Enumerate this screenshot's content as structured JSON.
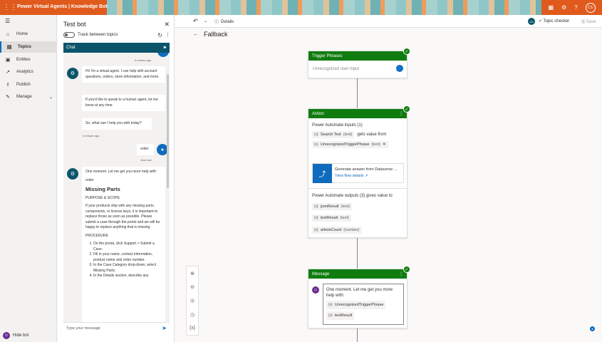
{
  "topbar": {
    "app_title": "Power Virtual Agents | Knowledge Bot",
    "avatar_initials": "CS"
  },
  "nav": {
    "items": [
      {
        "label": "Home"
      },
      {
        "label": "Topics"
      },
      {
        "label": "Entities"
      },
      {
        "label": "Analytics"
      },
      {
        "label": "Publish"
      },
      {
        "label": "Manage"
      }
    ],
    "hide_bot": "Hide bot"
  },
  "testbot": {
    "title": "Test bot",
    "track_label": "Track between topics",
    "chat_label": "Chat",
    "input_placeholder": "Type your message",
    "messages": {
      "ts1": "A minute ago",
      "m1": "Hi! I'm a virtual agent. I can help with account questions, orders, store information, and more.",
      "m2": "If you'd like to speak to a human agent, let me know at any time.",
      "m3": "So, what can I help you with today?",
      "ts2": "A minute ago",
      "user_msg": "order",
      "ts3": "Just now",
      "m4_intro": "One moment. Let me get you more help with:",
      "m4_term": "order",
      "m4_heading": "Missing Parts",
      "m4_purpose": "PURPOSE & SCOPE",
      "m4_body": "If your products ship with any missing parts, components, or license keys, it is important to replace those as soon as possible. Please submit a case through the portal and we will be happy to replace anything that is missing.",
      "m4_procedure": "PROCEDURE",
      "m4_steps": [
        "On the portal, click Support > Submit a Case.",
        "Fill in your name, contact information, product name and order number.",
        "In the Case Category drop-down, select Missing Parts.",
        "In the Details section, describe any"
      ]
    }
  },
  "canvas": {
    "details_label": "Details",
    "avatar_initials": "CS",
    "topic_checker": "Topic checker",
    "save_label": "Save",
    "page_title": "Fallback",
    "trigger": {
      "title": "Trigger Phrases",
      "text": "Unrecognized user input"
    },
    "action": {
      "title": "Action",
      "inputs_label": "Power Automate inputs (1)",
      "input_var": "Search Text",
      "input_type": "(text)",
      "gets_value_from": "gets value from",
      "source_var": "UnrecognizedTriggerPhrase",
      "source_type": "(text)",
      "flow_name": "Generate answer from Dataverse ...",
      "flow_link": "View flow details",
      "outputs_label": "Power Automate outputs (3) gives value to",
      "outputs": [
        {
          "name": "jsonResult",
          "type": "(text)"
        },
        {
          "name": "textResult",
          "type": "(text)"
        },
        {
          "name": "articleCount",
          "type": "(number)"
        }
      ]
    },
    "message": {
      "title": "Message",
      "text": "One moment. Let me get you more help with:",
      "var1": "UnrecognizedTriggerPhrase",
      "var2": "textResult"
    },
    "var_prefix": "{x}"
  }
}
